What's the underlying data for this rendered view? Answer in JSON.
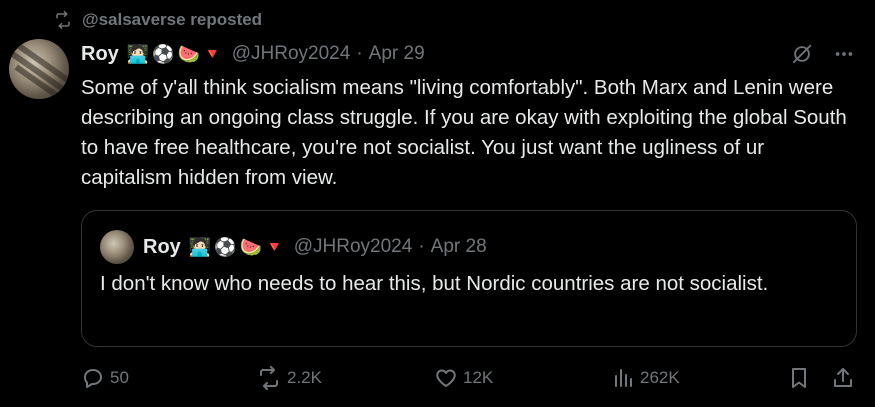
{
  "repost": {
    "text": "@salsaverse reposted"
  },
  "tweet": {
    "author_name": "Roy",
    "badges": [
      "🧑🏻‍💻",
      "⚽",
      "🍉",
      "🔻"
    ],
    "handle": "@JHRoy2024",
    "separator": "·",
    "date": "Apr 29",
    "text": "Some of y'all think socialism means \"living comfortably\". Both Marx and Lenin were describing an ongoing class struggle. If you are okay with exploiting the global South to have free healthcare, you're not socialist. You just want the ugliness of ur capitalism hidden from view."
  },
  "quote": {
    "author_name": "Roy",
    "badges": [
      "🧑🏻‍💻",
      "⚽",
      "🍉",
      "🔻"
    ],
    "handle": "@JHRoy2024",
    "separator": "·",
    "date": "Apr 28",
    "text": "I don't know who needs to hear this, but Nordic countries are not socialist."
  },
  "actions": {
    "replies": "50",
    "reposts": "2.2K",
    "likes": "12K",
    "views": "262K"
  },
  "colors": {
    "background": "#000000",
    "text": "#e7e9ea",
    "muted": "#71767b",
    "border": "#2f3336"
  }
}
